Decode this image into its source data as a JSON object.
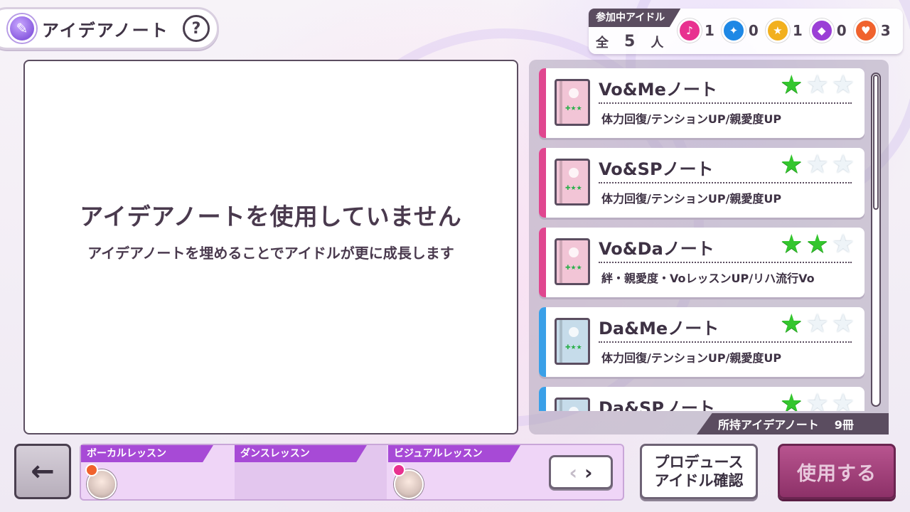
{
  "header": {
    "title": "アイデアノート",
    "help_label": "?"
  },
  "idols": {
    "tag": "参加中アイドル",
    "total_prefix": "全",
    "total_count": "5",
    "total_suffix": "人",
    "stats": [
      {
        "icon": "vocal-icon",
        "color": "#e8318f",
        "value": "1"
      },
      {
        "icon": "dance-icon",
        "color": "#1e88e5",
        "value": "0"
      },
      {
        "icon": "visual-icon",
        "color": "#f2b01e",
        "value": "1"
      },
      {
        "icon": "mental-icon",
        "color": "#9b3fd6",
        "value": "0"
      },
      {
        "icon": "heart-icon",
        "color": "#f0622d",
        "value": "3"
      }
    ]
  },
  "main": {
    "title": "アイデアノートを使用していません",
    "subtitle": "アイデアノートを埋めることでアイドルが更に成長します"
  },
  "notes": [
    {
      "name": "Vo&Meノート",
      "desc": "体力回復/テンションUP/親愛度UP",
      "accent": "#e0468f",
      "book": "#f2c5d6",
      "stars_on": 1,
      "stars_total": 3
    },
    {
      "name": "Vo&SPノート",
      "desc": "体力回復/テンションUP/親愛度UP",
      "accent": "#e0468f",
      "book": "#f2c5d6",
      "stars_on": 1,
      "stars_total": 3
    },
    {
      "name": "Vo&Daノート",
      "desc": "絆・親愛度・VoレッスンUP/リハ流行Vo",
      "accent": "#e0468f",
      "book": "#f2c5d6",
      "stars_on": 2,
      "stars_total": 3
    },
    {
      "name": "Da&Meノート",
      "desc": "体力回復/テンションUP/親愛度UP",
      "accent": "#3aa0e8",
      "book": "#c6dcea",
      "stars_on": 1,
      "stars_total": 3
    },
    {
      "name": "Da&SPノート",
      "desc": "",
      "accent": "#3aa0e8",
      "book": "#c6dcea",
      "stars_on": 1,
      "stars_total": 3
    }
  ],
  "owned": {
    "label": "所持アイデアノート",
    "count": "9冊"
  },
  "lessons": [
    {
      "label": "ボーカルレッスン",
      "has_idol": true,
      "badge_color": "#f0622d"
    },
    {
      "label": "ダンスレッスン",
      "has_idol": false,
      "badge_color": ""
    },
    {
      "label": "ビジュアルレッスン",
      "has_idol": true,
      "badge_color": "#e8318f"
    }
  ],
  "buttons": {
    "back": "←",
    "prev": "‹",
    "next": "›",
    "produce": "プロデュース\nアイドル確認",
    "use": "使用する"
  }
}
